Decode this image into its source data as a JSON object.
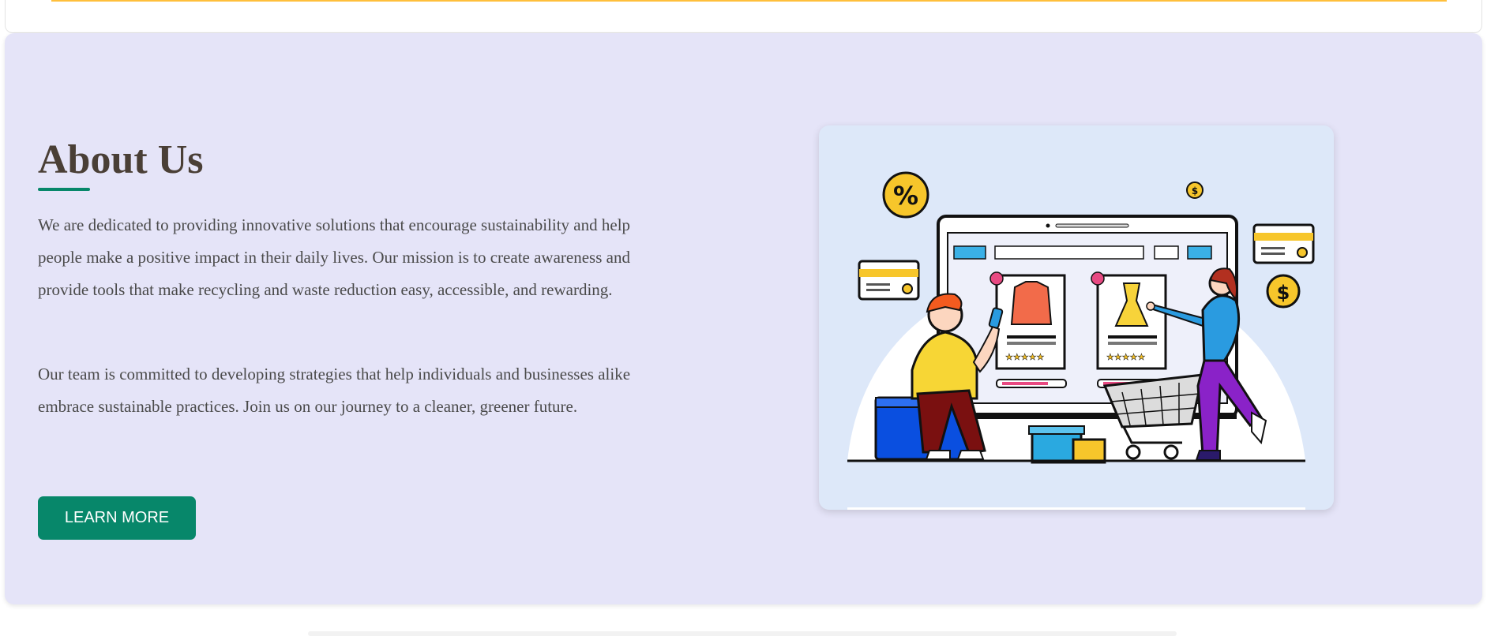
{
  "about": {
    "title": "About Us",
    "paragraphs": [
      "We are dedicated to providing innovative solutions that encourage sustainability and help people make a positive impact in their daily lives. Our mission is to create awareness and provide tools that make recycling and waste reduction easy, accessible, and rewarding.",
      "Our team is committed to developing strategies that help individuals and businesses alike embrace sustainable practices. Join us on our journey to a cleaner, greener future."
    ],
    "button_label": "LEARN MORE"
  },
  "illustration": {
    "percent_symbol": "%",
    "dollar_symbol": "$"
  },
  "colors": {
    "accent_green": "#07876a",
    "section_bg": "#e5e4f8",
    "top_strip": "#ffbf3c",
    "title_color": "#4a3f36"
  }
}
